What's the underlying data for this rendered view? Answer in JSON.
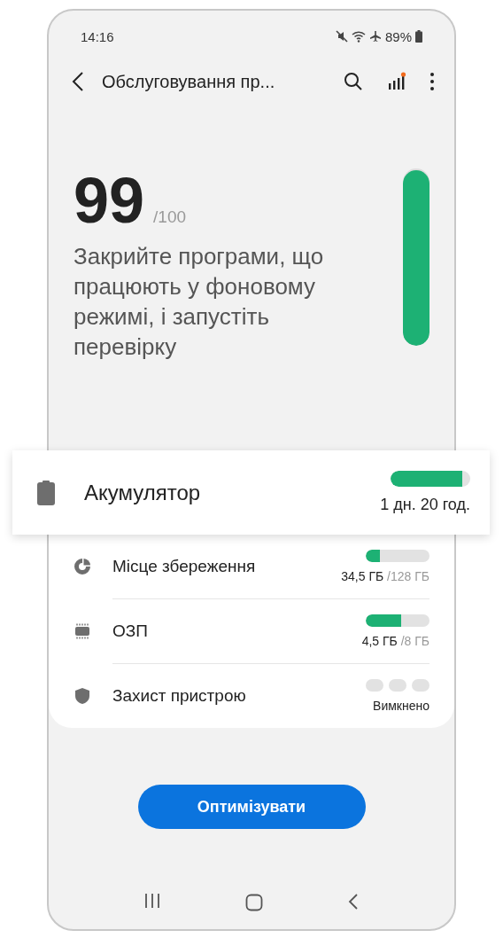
{
  "status_bar": {
    "time": "14:16",
    "battery": "89%"
  },
  "header": {
    "title": "Обслуговування пр..."
  },
  "score": {
    "value": "99",
    "max": "/100",
    "level": 0.99,
    "message": "Закрийте програми, що працюють у фоновому режимі, і запустіть перевірку"
  },
  "battery_card": {
    "label": "Акумулятор",
    "reading": "1 дн. 20 год.",
    "level": 0.9
  },
  "items": [
    {
      "kind": "bar",
      "label": "Місце збереження",
      "used": "34,5 ГБ",
      "total": "/128 ГБ",
      "level": 0.22
    },
    {
      "kind": "bar",
      "label": "ОЗП",
      "used": "4,5 ГБ",
      "total": "/8 ГБ",
      "level": 0.55
    },
    {
      "kind": "segments",
      "label": "Захист пристрою",
      "reading": "Вимкнено",
      "segments": [
        {
          "filled": false
        },
        {
          "filled": false
        },
        {
          "filled": false
        }
      ]
    }
  ],
  "button": "Оптимізувати"
}
